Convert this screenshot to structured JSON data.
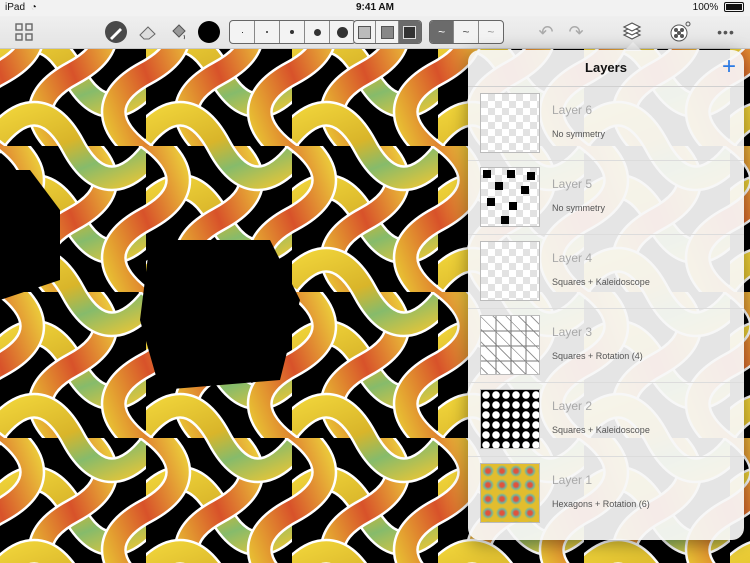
{
  "status_bar": {
    "device": "iPad",
    "time": "9:41 AM",
    "battery": "100%"
  },
  "toolbar": {
    "brush_color": "#000000",
    "brush_sizes": [
      "size-1",
      "size-2",
      "size-3",
      "size-4",
      "size-5"
    ],
    "layer_modes": [
      "mode-1",
      "mode-2",
      "mode-3"
    ],
    "stroke_styles": [
      "style-1",
      "style-2",
      "style-3"
    ]
  },
  "layers_panel": {
    "title": "Layers",
    "add_label": "+",
    "layers": [
      {
        "name": "Layer 6",
        "symmetry": "No symmetry",
        "thumbnail": "transparent"
      },
      {
        "name": "Layer 5",
        "symmetry": "No symmetry",
        "thumbnail": "black-squares"
      },
      {
        "name": "Layer 4",
        "symmetry": "Squares + Kaleidoscope",
        "thumbnail": "transparent"
      },
      {
        "name": "Layer 3",
        "symmetry": "Squares + Rotation (4)",
        "thumbnail": "grey-weave"
      },
      {
        "name": "Layer 2",
        "symmetry": "Squares + Kaleidoscope",
        "thumbnail": "white-circles-on-black"
      },
      {
        "name": "Layer 1",
        "symmetry": "Hexagons + Rotation (6)",
        "thumbnail": "yellow-flowers"
      }
    ]
  },
  "colors": {
    "accent": "#2a7ae4",
    "canvas_bg": "#000000",
    "ribbon": "#e8c433",
    "ribbon_green": "#7dbb6a",
    "ribbon_red": "#d9452a"
  }
}
